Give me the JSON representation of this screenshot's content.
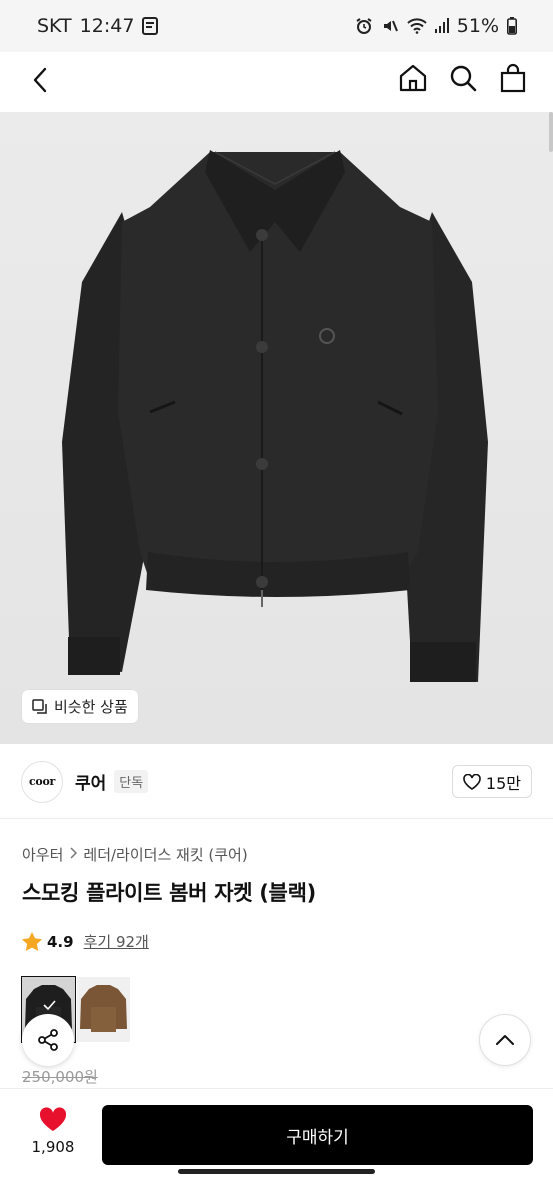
{
  "status_bar": {
    "carrier": "SKT",
    "time": "12:47",
    "battery": "51%",
    "icons": [
      "alarm-icon",
      "mute-icon",
      "wifi-icon",
      "signal-icon",
      "battery-icon"
    ]
  },
  "header": {
    "icons": [
      "back-icon",
      "home-icon",
      "search-icon",
      "shopping-bag-icon"
    ]
  },
  "product_image": {
    "similar_label": "비슷한 상품"
  },
  "brand": {
    "logo_text": "coor",
    "name": "쿠어",
    "badge": "단독",
    "likes": "15만"
  },
  "breadcrumb": {
    "category": "아우터",
    "subcategory": "레더/라이더스 재킷 (쿠어)"
  },
  "product": {
    "title": "스모킹 플라이트 봄버 자켓 (블랙)",
    "rating": "4.9",
    "reviews": "후기 92개",
    "original_price": "250,000원",
    "colors": [
      "black",
      "brown"
    ]
  },
  "bottom_bar": {
    "wish_count": "1,908",
    "buy_label": "구매하기"
  },
  "colors": {
    "accent_heart": "#e8112d",
    "star": "#f5a623",
    "buy_button": "#000000"
  }
}
